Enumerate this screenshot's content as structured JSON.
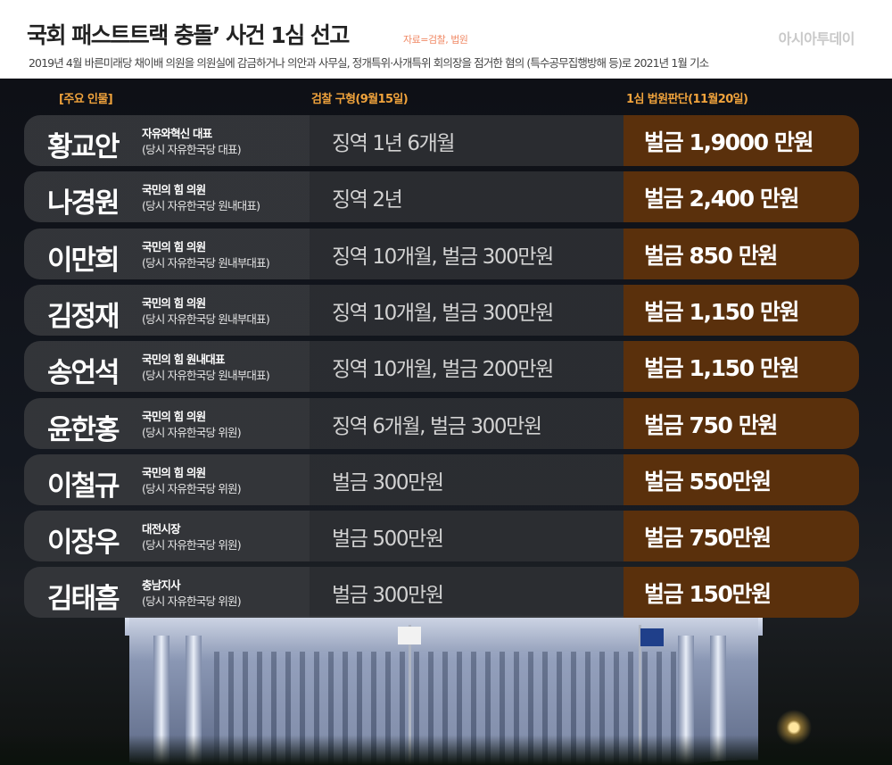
{
  "header": {
    "title": "국회 패스트트랙 충돌’ 사건 1심 선고",
    "source": "자료=검찰, 법원",
    "brand": "아시아투데이",
    "subtitle": "2019년 4월 바른미래당 채이배 의원을 의원실에 감금하거나 의안과 사무실, 정개특위·사개특위 회의장을 점거한 혐의 (특수공무집행방해 등)로 2021년 1월 기소"
  },
  "columns": {
    "people": "[주요 인물]",
    "prosecution": "검찰 구형(9월15일)",
    "verdict": "1심 법원판단(11월20일)"
  },
  "rows": [
    {
      "name": "황교안",
      "role": "자유와혁신 대표",
      "prev": "(당시 자유한국당 대표)",
      "demand": "징역 1년 6개월",
      "verdict": "벌금 1,9000 만원"
    },
    {
      "name": "나경원",
      "role": "국민의 힘 의원",
      "prev": "(당시 자유한국당 원내대표)",
      "demand": "징역 2년",
      "verdict": "벌금 2,400 만원"
    },
    {
      "name": "이만희",
      "role": "국민의 힘 의원",
      "prev": "(당시 자유한국당 원내부대표)",
      "demand": "징역 10개월, 벌금 300만원",
      "verdict": "벌금 850 만원"
    },
    {
      "name": "김정재",
      "role": "국민의 힘 의원",
      "prev": "(당시 자유한국당 원내부대표)",
      "demand": "징역 10개월, 벌금 300만원",
      "verdict": "벌금 1,150 만원"
    },
    {
      "name": "송언석",
      "role": "국민의 힘 원내대표",
      "prev": "(당시 자유한국당 원내부대표)",
      "demand": "징역 10개월, 벌금 200만원",
      "verdict": "벌금 1,150 만원"
    },
    {
      "name": "윤한홍",
      "role": "국민의 힘 의원",
      "prev": "(당시 자유한국당 위원)",
      "demand": "징역 6개월, 벌금 300만원",
      "verdict": "벌금 750 만원"
    },
    {
      "name": "이철규",
      "role": "국민의 힘 의원",
      "prev": "(당시 자유한국당 위원)",
      "demand": "벌금 300만원",
      "verdict": "벌금 550만원"
    },
    {
      "name": "이장우",
      "role": "대전시장",
      "prev": "(당시 자유한국당 위원)",
      "demand": "벌금 500만원",
      "verdict": "벌금 750만원"
    },
    {
      "name": "김태흠",
      "role": "충남지사",
      "prev": "(당시 자유한국당 위원)",
      "demand": "벌금 300만원",
      "verdict": "벌금 150만원"
    }
  ],
  "colors": {
    "column_header": "#f0a33c",
    "verdict_cell": "#5a300c",
    "row_bg": "#34363a",
    "source_text": "#f08a66"
  }
}
